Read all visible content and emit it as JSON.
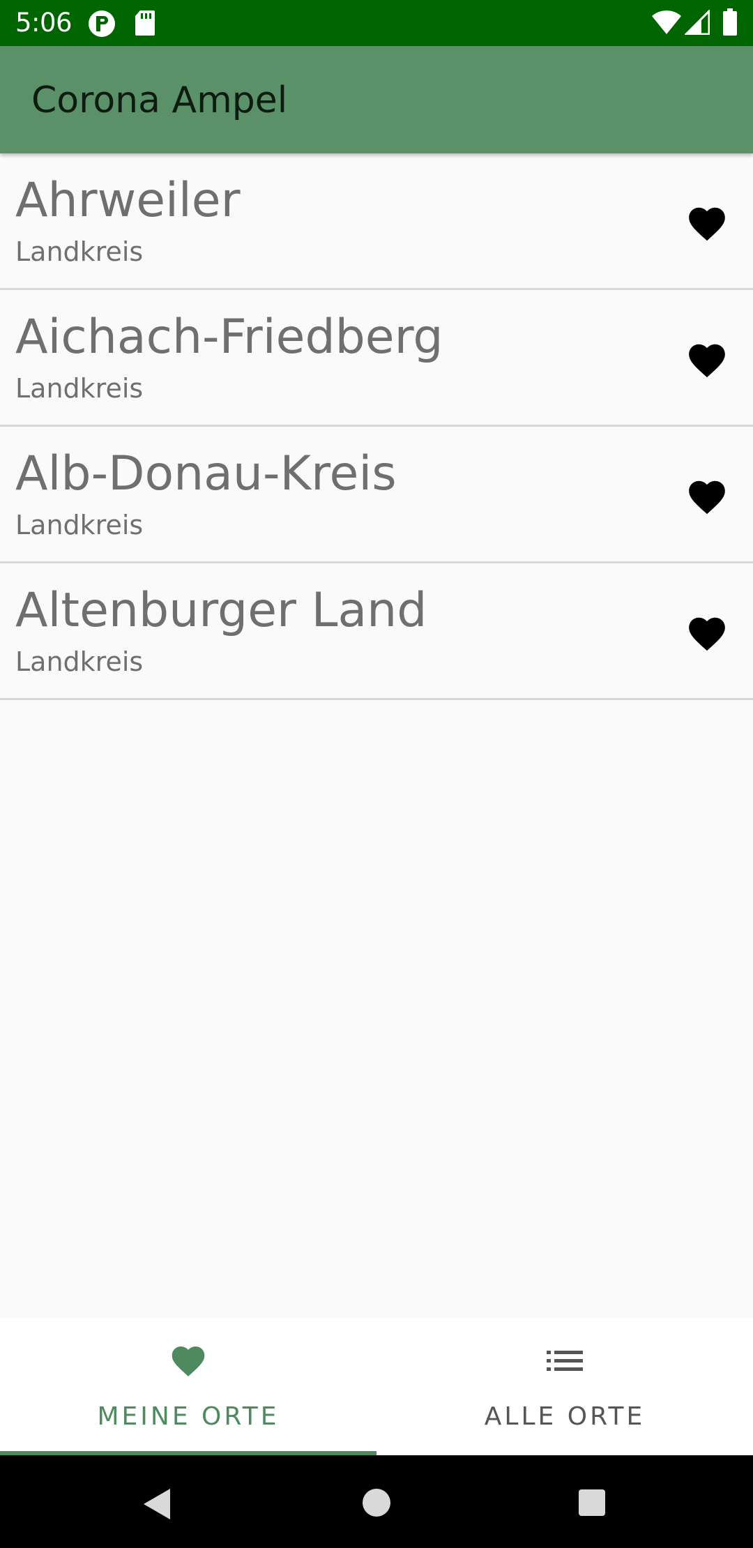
{
  "status_bar": {
    "time": "5:06",
    "icons": [
      "p-icon",
      "sd-card-icon",
      "wifi-icon",
      "signal-icon",
      "battery-icon"
    ]
  },
  "app_bar": {
    "title": "Corona Ampel"
  },
  "list": {
    "items": [
      {
        "name": "Ahrweiler",
        "type": "Landkreis",
        "favorite": true
      },
      {
        "name": "Aichach-Friedberg",
        "type": "Landkreis",
        "favorite": true
      },
      {
        "name": "Alb-Donau-Kreis",
        "type": "Landkreis",
        "favorite": true
      },
      {
        "name": "Altenburger Land",
        "type": "Landkreis",
        "favorite": true
      }
    ]
  },
  "tabs": [
    {
      "label": "MEINE ORTE",
      "icon": "heart-icon",
      "selected": true
    },
    {
      "label": "ALLE ORTE",
      "icon": "list-icon",
      "selected": false
    }
  ],
  "colors": {
    "status_bar": "#006400",
    "app_bar": "#5a9168",
    "accent": "#4f8a5f",
    "text_secondary": "#6f6f6f"
  },
  "system_nav": [
    "back-icon",
    "home-icon",
    "recents-icon"
  ]
}
